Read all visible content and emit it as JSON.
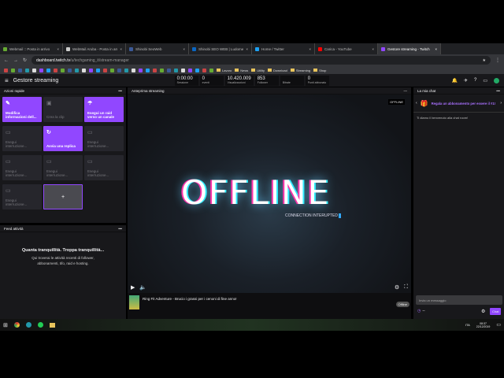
{
  "browser": {
    "tabs": [
      {
        "title": "Webmail :: Posta in arrivo",
        "color": "#6a3"
      },
      {
        "title": "WebMail Aruba - Posta in arrivo",
        "color": "#ccc"
      },
      {
        "title": "Shinobi SeoWeb",
        "color": "#3b5998"
      },
      {
        "title": "Shinobi SEO WEB | Ludomedia",
        "color": "#0a66c2"
      },
      {
        "title": "Home / Twitter",
        "color": "#1da1f2"
      },
      {
        "title": "Carica - YouTube",
        "color": "#f00"
      },
      {
        "title": "Gestore streaming - Twitch",
        "color": "#9147ff"
      }
    ],
    "url_host": "dashboard.twitch.tv",
    "url_path": "/u/techgaming_it/stream-manager",
    "bookmark_folders": [
      "Lavoro",
      "News",
      "Utility",
      "Download",
      "Streaming",
      "Shop"
    ]
  },
  "header": {
    "title": "Gestore streaming",
    "stats": [
      {
        "value": "0:00:00",
        "label": "Sessione"
      },
      {
        "value": "0",
        "label": "eventi"
      },
      {
        "value": "10.420.009",
        "label": "Visualizzazioni"
      },
      {
        "value": "853",
        "label": "Follower"
      },
      {
        "value": "",
        "label": "Bitrate"
      },
      {
        "value": "0",
        "label": "Punti abbonato"
      }
    ]
  },
  "quick_actions": {
    "title": "Azioni rapide",
    "tiles": [
      {
        "label": "Modifica informazioni dell...",
        "active": true,
        "icon": "pencil"
      },
      {
        "label": "Crea la clip",
        "active": false,
        "icon": "clip"
      },
      {
        "label": "Esegui un raid verso un canale",
        "active": true,
        "icon": "raid"
      },
      {
        "label": "Esegui interruzione...",
        "active": false,
        "icon": "ad"
      },
      {
        "label": "Avvia una replica",
        "active": true,
        "icon": "replay"
      },
      {
        "label": "Esegui interruzione...",
        "active": false,
        "icon": "ad"
      },
      {
        "label": "Esegui interruzione...",
        "active": false,
        "icon": "ad"
      },
      {
        "label": "Esegui interruzione...",
        "active": false,
        "icon": "ad"
      },
      {
        "label": "Esegui interruzione...",
        "active": false,
        "icon": "ad"
      },
      {
        "label": "Esegui interruzione...",
        "active": false,
        "icon": "ad"
      }
    ],
    "add": "+"
  },
  "feed": {
    "title": "Feed attività",
    "heading": "Quanta tranquillità. Troppa tranquillità...",
    "body": "Qui troverai le attività recenti di follower, abbonamenti, tifo, raid e hosting."
  },
  "preview": {
    "title": "Anteprima streaming",
    "badge": "OFFLINE",
    "big": "OFFLINE",
    "sub": "CONNECTION INTERUPTED",
    "stream_title": "Ring Fit Adventure - Brucio i grassi per i cenoni di fine anno!",
    "status": "Offline"
  },
  "chat": {
    "title": "La mia chat",
    "promo": "Regala un abbonamento per essere il #1!",
    "welcome": "Ti diamo il benvenuto alla chat room!",
    "placeholder": "Invia un messaggio",
    "points": "--",
    "send": "Chat"
  },
  "taskbar": {
    "lang": "ITA",
    "time": "08:37",
    "date": "22/12/2019"
  }
}
